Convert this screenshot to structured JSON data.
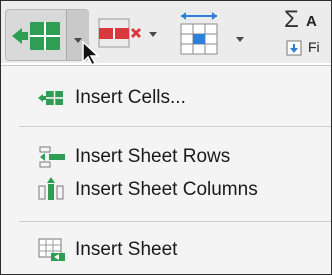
{
  "colors": {
    "green": "#2e9e55",
    "red": "#d9393e",
    "blue": "#2f7fd6"
  },
  "toolbar": {
    "insert_button_icon": "insert-cells-icon",
    "delete_button_icon": "delete-cells-icon",
    "format_button_icon": "format-icon",
    "autosum_label": "A",
    "fill_label": "Fi"
  },
  "menu": {
    "items": [
      {
        "label": "Insert Cells...",
        "icon": "insert-cells-icon"
      },
      {
        "label": "Insert Sheet Rows",
        "icon": "insert-rows-icon"
      },
      {
        "label": "Insert Sheet Columns",
        "icon": "insert-columns-icon"
      },
      {
        "label": "Insert Sheet",
        "icon": "insert-sheet-icon"
      }
    ]
  }
}
